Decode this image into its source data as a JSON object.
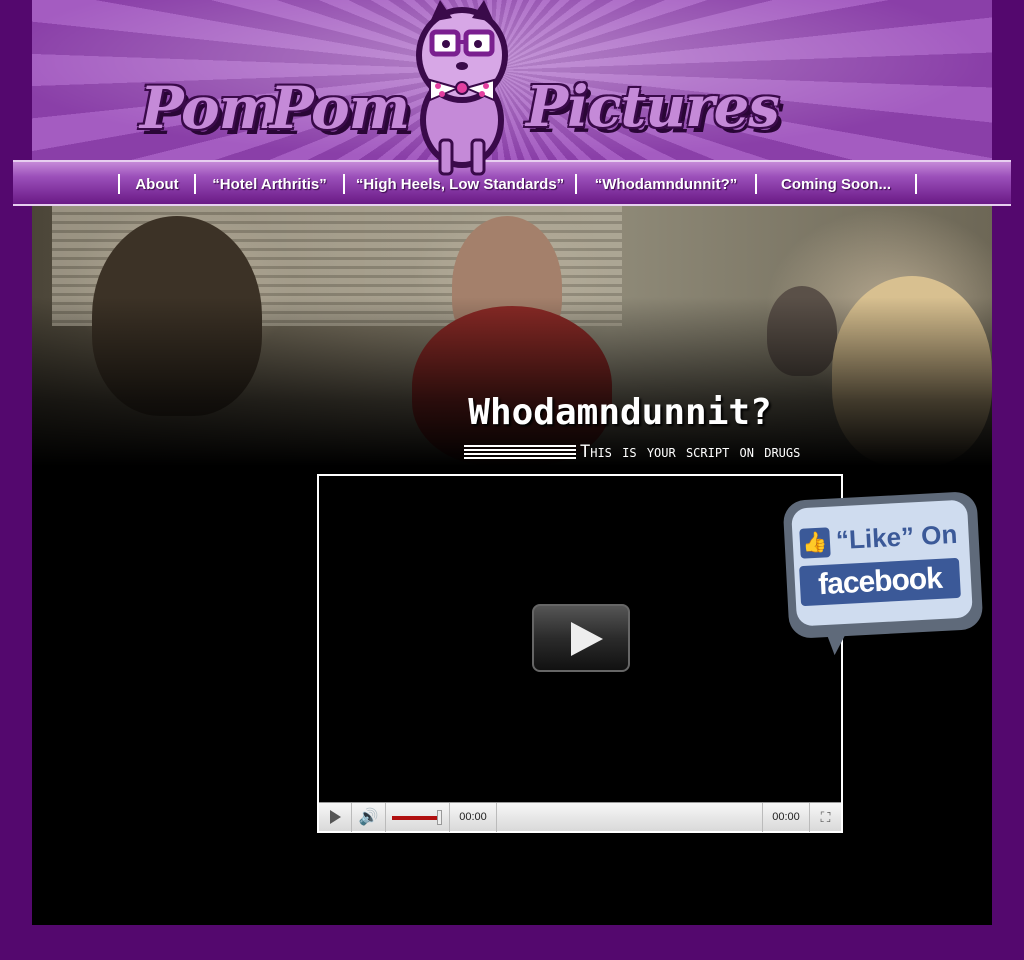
{
  "brand": {
    "logo_word_1": "Pom",
    "logo_word_2": "Pom",
    "logo_word_3": "Pictures"
  },
  "nav": {
    "items": [
      {
        "label": "About"
      },
      {
        "label": "“Hotel Arthritis”"
      },
      {
        "label": "“High Heels, Low Standards”"
      },
      {
        "label": "“Whodamndunnit?”"
      },
      {
        "label": "Coming Soon..."
      }
    ]
  },
  "feature": {
    "title": "Whodamndunnit?",
    "tagline": "This is your script on drugs"
  },
  "player": {
    "current_time": "00:00",
    "duration": "00:00",
    "volume_level": 0.95
  },
  "facebook": {
    "like_text": "“Like” On",
    "brand_text": "facebook"
  },
  "colors": {
    "page_background": "#54086e",
    "header_purple": "#a45cc1",
    "facebook_blue": "#3b5998",
    "volume_red": "#b01010"
  },
  "icons": {
    "play": "play-icon",
    "volume": "speaker-icon",
    "fullscreen": "fullscreen-icon",
    "thumbs_up": "thumbs-up-icon"
  }
}
